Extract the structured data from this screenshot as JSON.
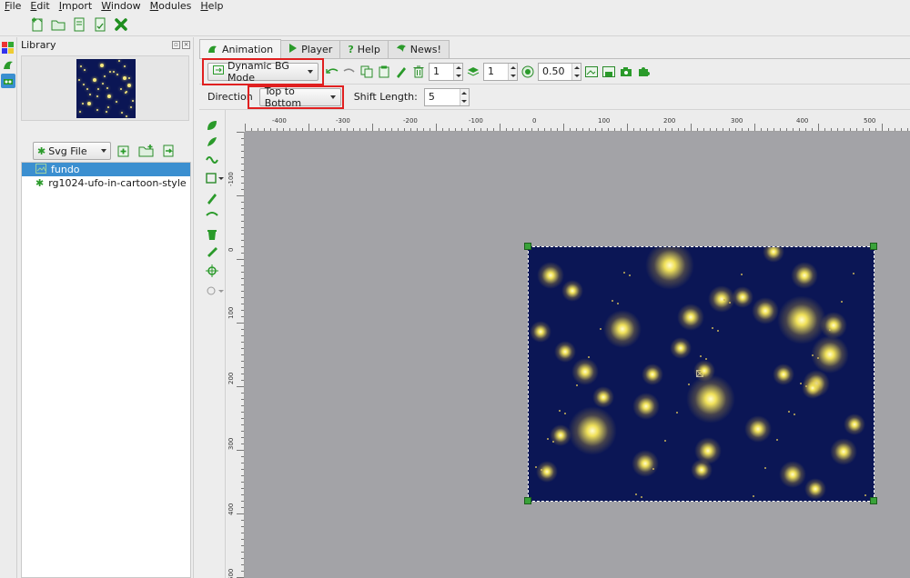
{
  "menubar": {
    "items": [
      "File",
      "Edit",
      "Import",
      "Window",
      "Modules",
      "Help"
    ]
  },
  "main_toolbar": {
    "icons": [
      "new-file-icon",
      "open-folder-icon",
      "save-icon",
      "save-as-icon",
      "close-x-icon"
    ]
  },
  "library": {
    "title": "Library",
    "source_select": "Svg File",
    "items": [
      {
        "label": "fundo",
        "selected": true
      },
      {
        "label": "rg1024-ufo-in-cartoon-style",
        "selected": false
      }
    ]
  },
  "tabs": [
    {
      "label": "Animation",
      "active": true
    },
    {
      "label": "Player",
      "active": false
    },
    {
      "label": "Help",
      "active": false
    },
    {
      "label": "News!",
      "active": false
    }
  ],
  "animation_toolbar": {
    "mode": "Dynamic BG Mode",
    "frame_spin_1": "1",
    "frame_spin_2": "1",
    "opacity": "0.50"
  },
  "options_bar": {
    "direction_label": "Direction",
    "direction_value": "Top to Bottom",
    "shift_label": "Shift Length:",
    "shift_value": "5"
  },
  "ruler": {
    "top_labels": [
      "-400",
      "-300",
      "-200",
      "-100",
      "0",
      "100",
      "200",
      "300",
      "400",
      "500"
    ],
    "left_labels": [
      "-100",
      "0",
      "100",
      "200",
      "300",
      "400",
      "500"
    ]
  },
  "colors": {
    "stage_bg": "#0b1655",
    "workspace_bg": "#a3a3a7",
    "accent": "#2a9a2a",
    "selection": "#3b8fd0",
    "highlight_box": "#e02020"
  }
}
